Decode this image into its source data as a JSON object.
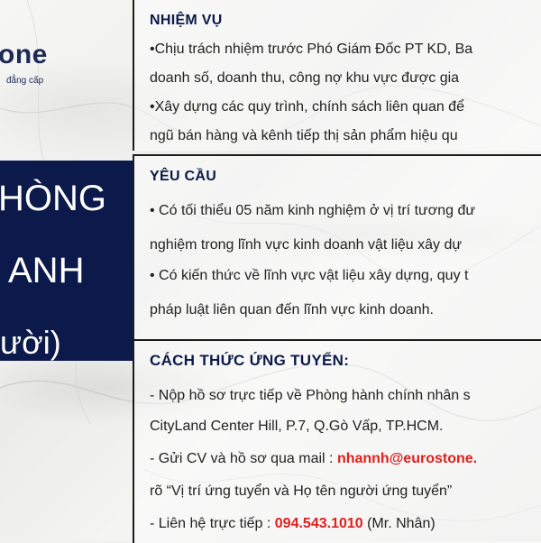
{
  "logo": {
    "name": "one",
    "tagline": "đẳng cấp"
  },
  "title": {
    "line1": "HÒNG",
    "line2": "ANH",
    "line3": "ười)"
  },
  "sections": {
    "duties": {
      "heading": "NHIỆM VỤ",
      "lines": [
        "•Chịu trách nhiệm trước Phó Giám Đốc PT KD, Ba",
        "doanh số, doanh thu, công nợ khu vực được gia",
        "•Xây dựng các quy trình, chính sách liên quan để",
        "ngũ bán hàng và kênh tiếp thị sản phẩm hiệu qu"
      ]
    },
    "requirements": {
      "heading": "YÊU CẦU",
      "lines": [
        "• Có tối thiểu 05 năm kinh nghiệm ở vị trí tương đư",
        "nghiệm trong lĩnh vực kinh doanh vật liệu xây dự",
        "• Có kiến thức về lĩnh vực vật liệu xây dựng, quy t",
        "pháp luật liên quan đến lĩnh vực kinh doanh."
      ]
    },
    "apply": {
      "heading": "CÁCH THỨC ỨNG TUYỂN:",
      "line1": "- Nộp hồ sơ trực tiếp về Phòng hành chính nhân s",
      "line2": "CityLand Center Hill, P.7, Q.Gò Vấp, TP.HCM.",
      "line3_prefix": "- Gửi CV và hồ sơ qua mail : ",
      "email": "nhannh@eurostone.",
      "line4": "rõ “Vị trí ứng tuyển và Họ tên người ứng tuyển”",
      "line5_prefix": "- Liên hệ trực tiếp : ",
      "phone": "094.543.1010",
      "line5_suffix": " (Mr. Nhân)"
    }
  },
  "colors": {
    "navy": "#0b1a4a",
    "accent": "#e0201e"
  }
}
